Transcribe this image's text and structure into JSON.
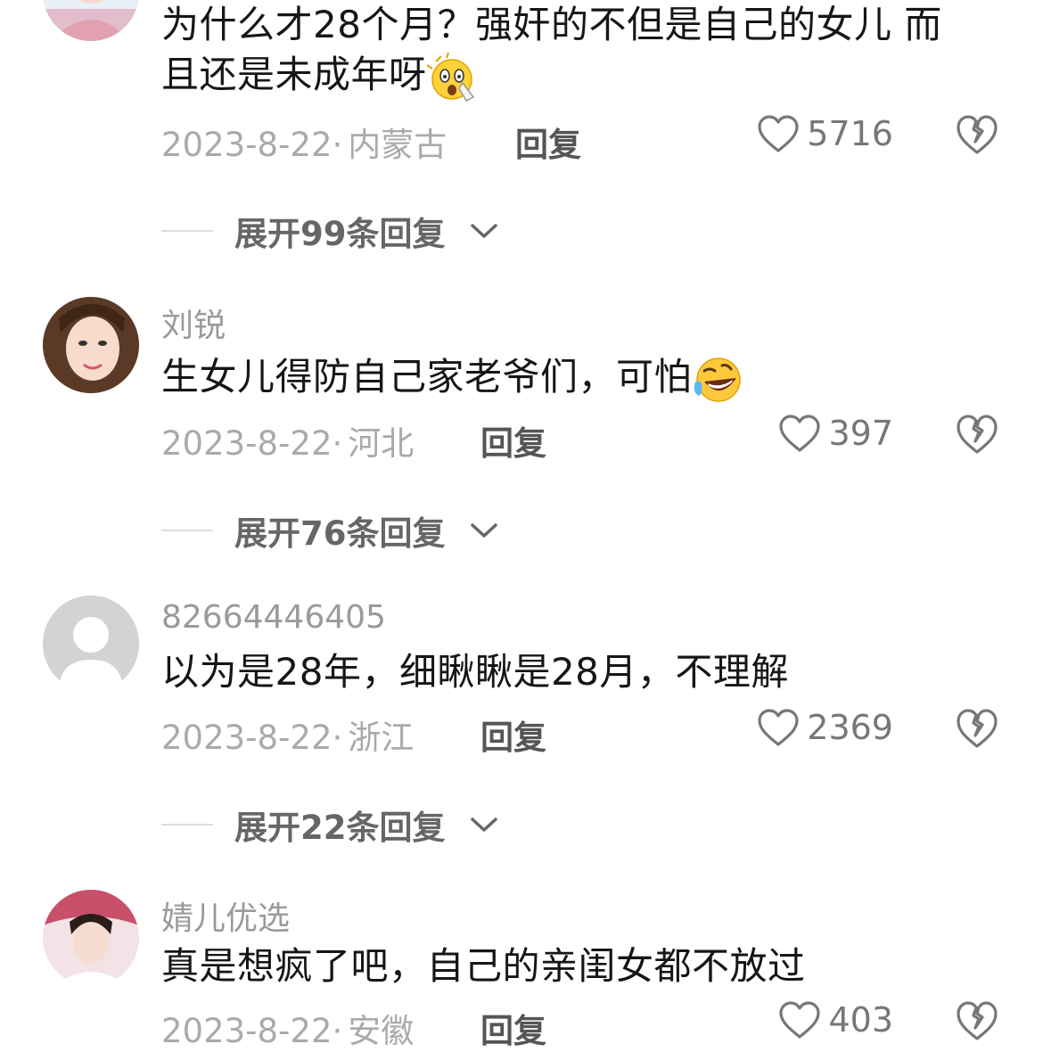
{
  "comments": [
    {
      "username": "",
      "text_line1": "为什么才28个月？强奸的不但是自己的女儿 而",
      "text_line2": "且还是未成年呀",
      "emoji": "screaming-shocked-face",
      "date": "2023-8-22·",
      "location": "内蒙古",
      "reply_label": "回复",
      "likes": "5716",
      "expand_label": "展开99条回复"
    },
    {
      "username": "刘锐",
      "text_line1": "生女儿得防自己家老爷们，可怕",
      "emoji": "rolling-laughing-face",
      "date": "2023-8-22·",
      "location": "河北",
      "reply_label": "回复",
      "likes": "397",
      "expand_label": "展开76条回复"
    },
    {
      "username": "82664446405",
      "text_line1": "以为是28年，细瞅瞅是28月，不理解",
      "date": "2023-8-22·",
      "location": "浙江",
      "reply_label": "回复",
      "likes": "2369",
      "expand_label": "展开22条回复"
    },
    {
      "username": "婧儿优选",
      "text_line1": "真是想疯了吧，自己的亲闺女都不放过",
      "date": "2023-8-22·",
      "location": "安徽",
      "reply_label": "回复",
      "likes": "403"
    }
  ],
  "icons": {
    "like": "heart-outline-icon",
    "dislike": "broken-heart-icon",
    "expand": "chevron-down-icon"
  },
  "colors": {
    "text": "#161616",
    "meta": "#aaaaaa",
    "username": "#9a9a9a",
    "action": "#555555"
  }
}
